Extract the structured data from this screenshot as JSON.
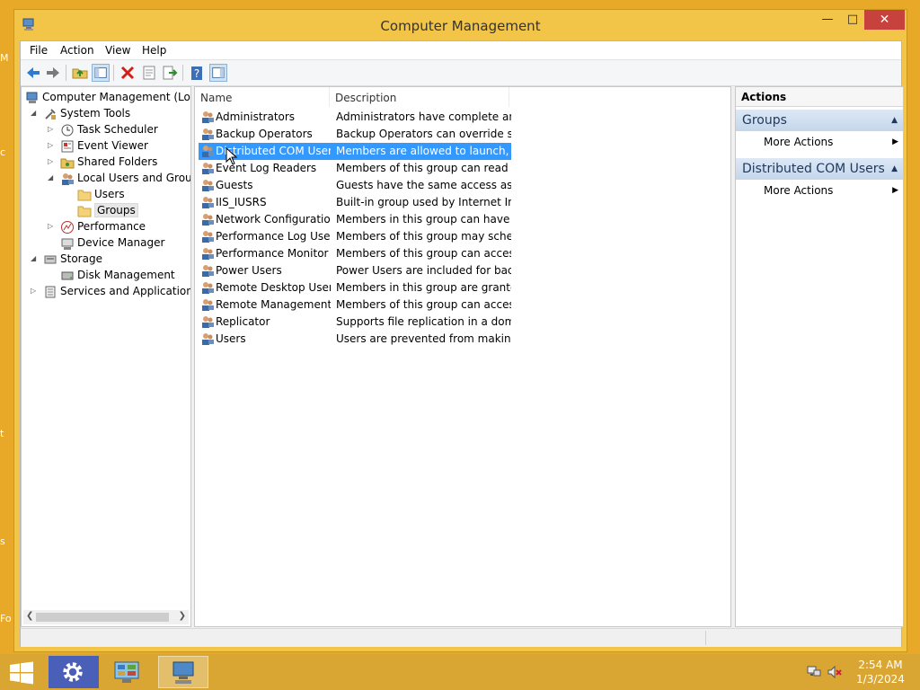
{
  "window": {
    "title": "Computer Management"
  },
  "desktop_fragments": [
    "M",
    "c",
    "t",
    "s",
    "Fo"
  ],
  "menu": [
    "File",
    "Action",
    "View",
    "Help"
  ],
  "toolbar": {
    "buttons": [
      "back-icon",
      "forward-icon",
      "up-folder-icon",
      "show-hide-tree-icon",
      "delete-icon",
      "properties-icon",
      "export-list-icon",
      "help-icon",
      "action-pane-toggle-icon"
    ]
  },
  "tree": {
    "items": [
      {
        "label": "Computer Management (Local",
        "icon": "computer-management-icon"
      },
      {
        "label": "System Tools",
        "icon": "tools-icon"
      },
      {
        "label": "Task Scheduler",
        "icon": "clock-icon"
      },
      {
        "label": "Event Viewer",
        "icon": "event-viewer-icon"
      },
      {
        "label": "Shared Folders",
        "icon": "shared-folder-icon"
      },
      {
        "label": "Local Users and Groups",
        "icon": "users-icon"
      },
      {
        "label": "Users",
        "icon": "folder-icon"
      },
      {
        "label": "Groups",
        "icon": "folder-icon"
      },
      {
        "label": "Performance",
        "icon": "performance-icon"
      },
      {
        "label": "Device Manager",
        "icon": "device-manager-icon"
      },
      {
        "label": "Storage",
        "icon": "storage-icon"
      },
      {
        "label": "Disk Management",
        "icon": "disk-icon"
      },
      {
        "label": "Services and Applications",
        "icon": "services-icon"
      }
    ]
  },
  "list": {
    "columns": [
      "Name",
      "Description"
    ],
    "rows": [
      {
        "name": "Administrators",
        "description": "Administrators have complete an..."
      },
      {
        "name": "Backup Operators",
        "description": "Backup Operators can override se..."
      },
      {
        "name": "Distributed COM Users",
        "description": "Members are allowed to launch, a...",
        "selected": true
      },
      {
        "name": "Event Log Readers",
        "description": "Members of this group can read e..."
      },
      {
        "name": "Guests",
        "description": "Guests have the same access as m..."
      },
      {
        "name": "IIS_IUSRS",
        "description": "Built-in group used by Internet Inf..."
      },
      {
        "name": "Network Configuratio...",
        "description": "Members in this group can have s..."
      },
      {
        "name": "Performance Log Users",
        "description": "Members of this group may sche..."
      },
      {
        "name": "Performance Monitor ...",
        "description": "Members of this group can acces..."
      },
      {
        "name": "Power Users",
        "description": "Power Users are included for back..."
      },
      {
        "name": "Remote Desktop Users",
        "description": "Members in this group are grante..."
      },
      {
        "name": "Remote Management...",
        "description": "Members of this group can acces..."
      },
      {
        "name": "Replicator",
        "description": "Supports file replication in a dom..."
      },
      {
        "name": "Users",
        "description": "Users are prevented from making ..."
      }
    ]
  },
  "actions": {
    "title": "Actions",
    "sections": [
      {
        "header": "Groups",
        "item": "More Actions"
      },
      {
        "header": "Distributed COM Users",
        "item": "More Actions"
      }
    ]
  },
  "taskbar": {
    "apps": [
      "settings-icon",
      "control-panel-icon",
      "computer-management-icon"
    ],
    "time": "2:54 AM",
    "date": "1/3/2024"
  },
  "colors": {
    "desktop": "#e8a928",
    "selection": "#3399ff",
    "close_button": "#c7413d"
  }
}
